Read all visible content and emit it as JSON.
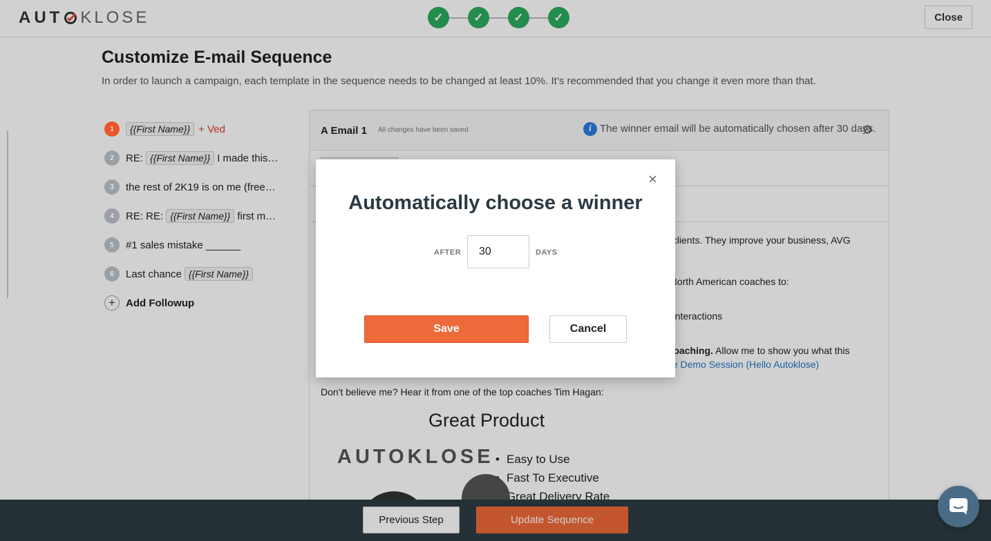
{
  "header": {
    "logo_bold": "AUT",
    "logo_light": "KLOSE",
    "steps": [
      "✓",
      "✓",
      "✓",
      "✓"
    ],
    "close_label": "Close"
  },
  "page": {
    "title": "Customize E-mail Sequence",
    "subtitle": "In order to launch a campaign, each template in the sequence needs to be changed at least 10%. It’s recommended that you change it even more than that."
  },
  "sequence": {
    "items": [
      {
        "num": "1",
        "tag": "{{First Name}}",
        "suffix": "+ Ved"
      },
      {
        "num": "2",
        "prefix": "RE:",
        "tag": "{{First Name}}",
        "suffix": "I made this…"
      },
      {
        "num": "3",
        "text": "the rest of 2K19 is on me (free…"
      },
      {
        "num": "4",
        "prefix": "RE: RE:",
        "tag": "{{First Name}}",
        "suffix": "first m…"
      },
      {
        "num": "5",
        "text": "#1 sales mistake ______"
      },
      {
        "num": "6",
        "prefix": "Last chance",
        "tag": "{{First Name}}"
      }
    ],
    "add_label": "Add Followup",
    "add_icon": "plus-icon"
  },
  "email": {
    "name": "A Email 1",
    "saved_note": "All changes have been saved",
    "info_icon": "i",
    "winner_note": "The winner email will be automatically chosen after 30 days.",
    "gear_icon": "⚙",
    "body_lines": {
      "l1": "el clients. They improve your business, AVG",
      "l2": "n North American coaches to:",
      "l3": "nt interactions",
      "l4_bold": "- coaching.",
      "l4_rest": " Allow me to show you what this",
      "l5_link": "ose Demo Session (Hello Autoklose)",
      "l6": "Don't believe me? Hear it from one of the top coaches Tim Hagan:"
    },
    "promo": {
      "title": "Great Product",
      "logo": "AUTOKLOSE",
      "bullets": [
        "Easy to Use",
        "Fast To Executive",
        "Great Delivery Rate"
      ]
    }
  },
  "footer": {
    "previous_label": "Previous Step",
    "update_label": "Update Sequence"
  },
  "modal": {
    "title": "Automatically choose a winner",
    "close_icon": "×",
    "after_label": "AFTER",
    "days_value": "30",
    "days_label": "DAYS",
    "save_label": "Save",
    "cancel_label": "Cancel"
  },
  "colors": {
    "accent_orange": "#ee6a3a",
    "success_green": "#2cab5f",
    "link_blue": "#2577c4",
    "footer_bg": "#2e3c44"
  }
}
